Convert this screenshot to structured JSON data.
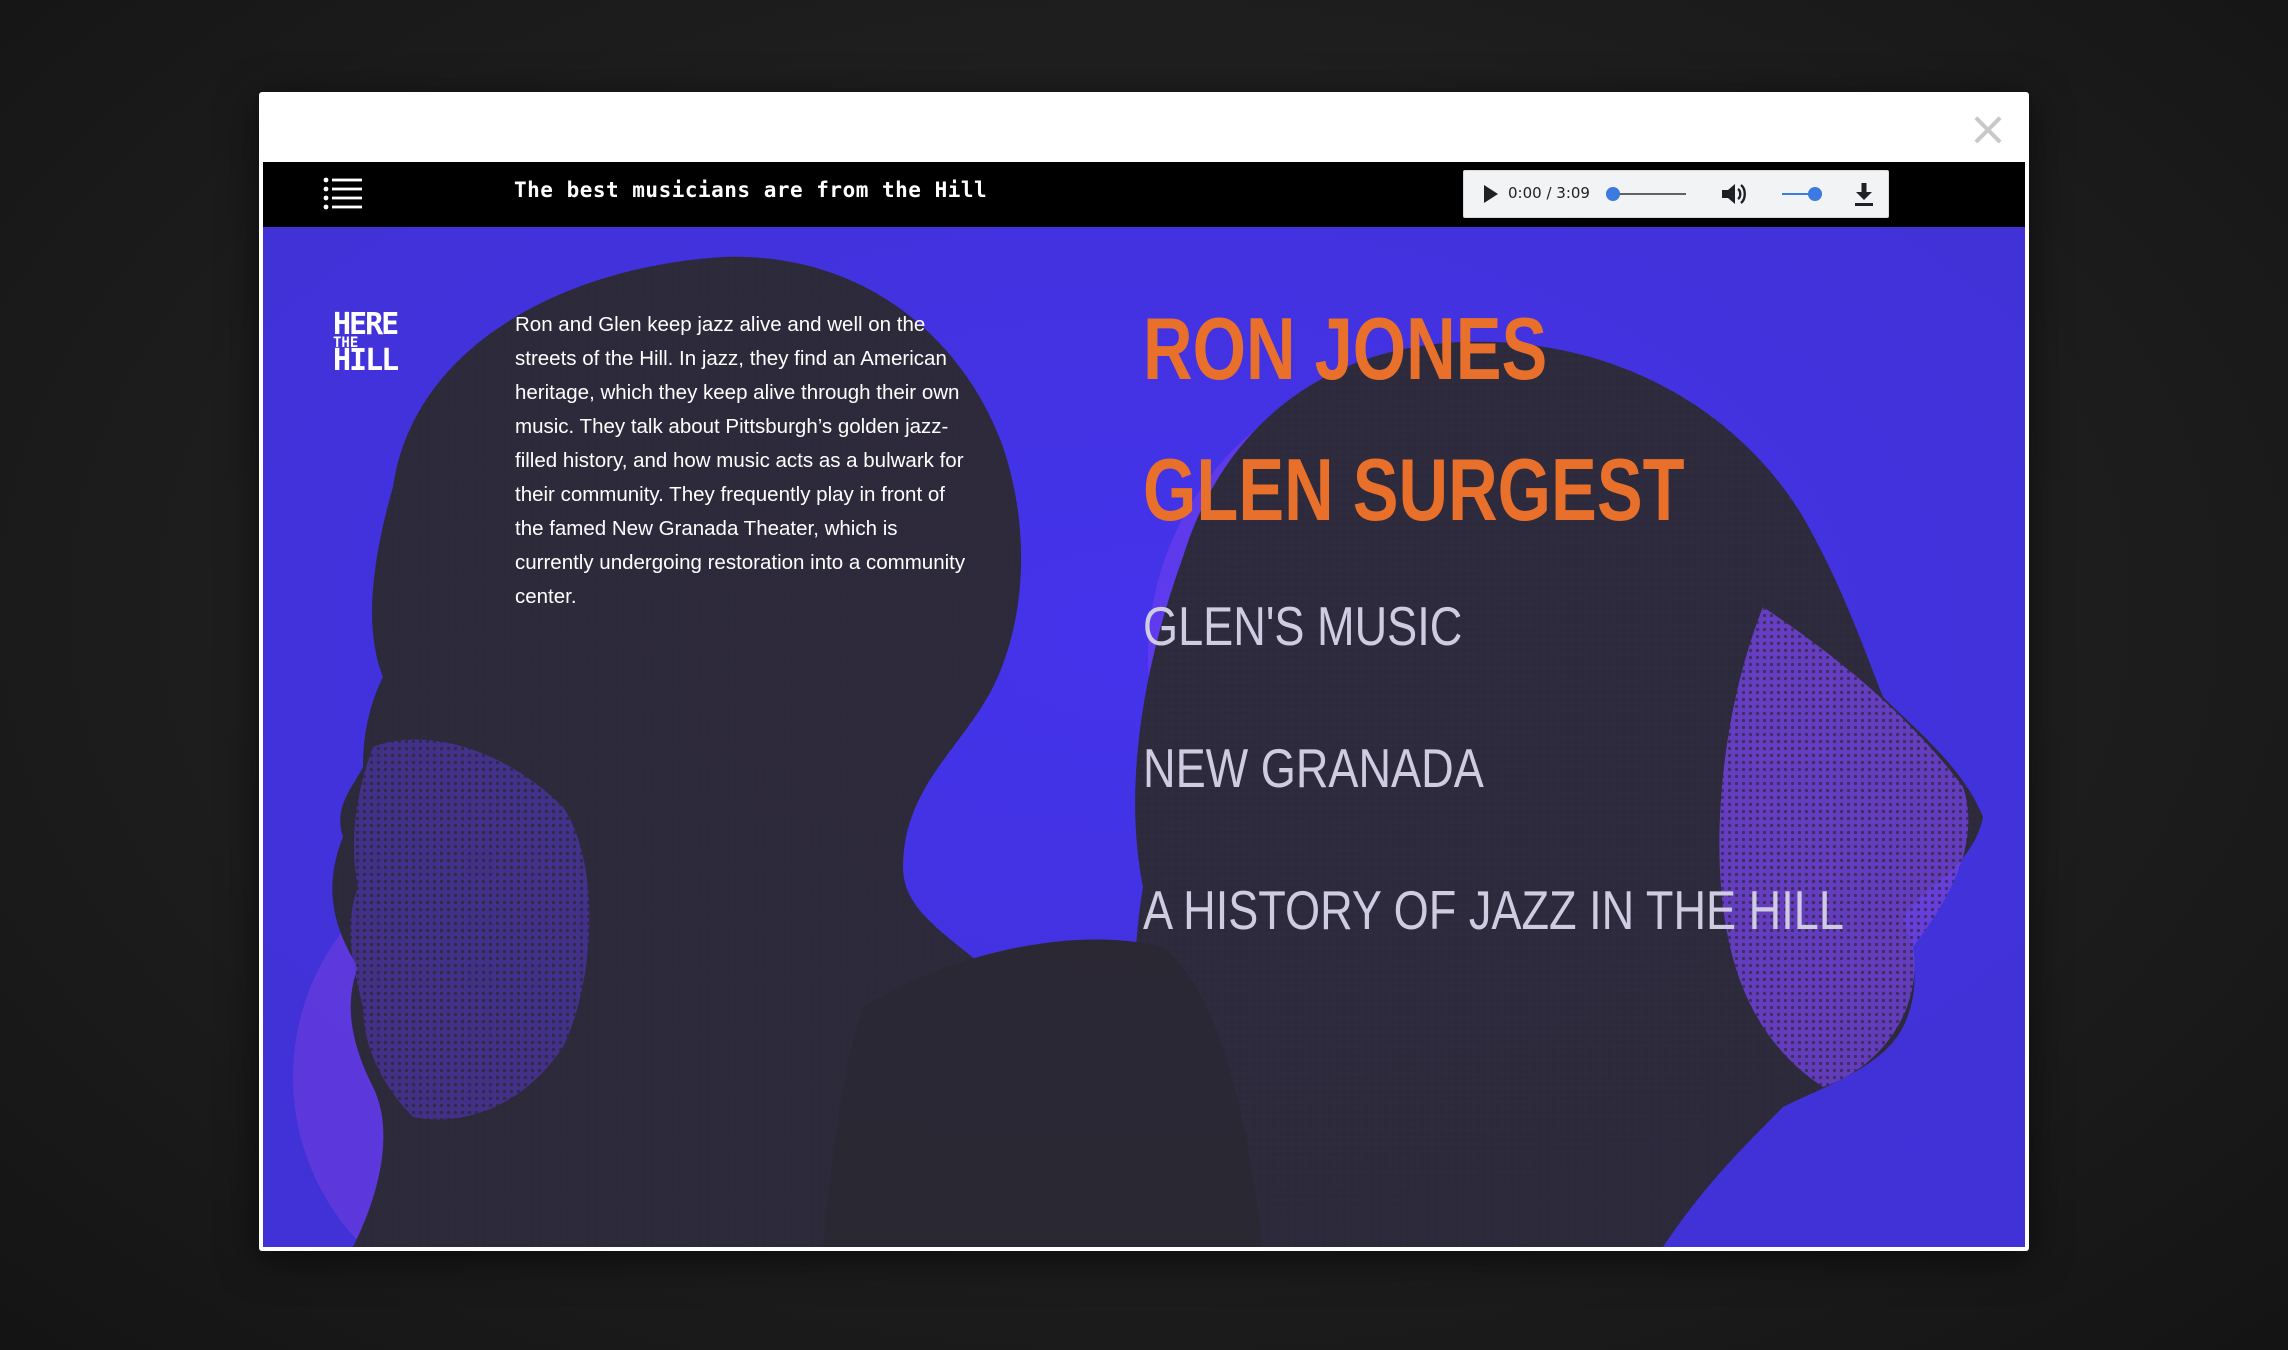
{
  "modal": {
    "close_label": "×"
  },
  "topbar": {
    "menu_icon": "menu-list-icon",
    "title": "The best musicians are from the Hill"
  },
  "audio": {
    "play_icon": "play-icon",
    "time": "0:00 / 3:09",
    "progress": 0.0,
    "volume_icon": "volume-icon",
    "volume": 0.8,
    "download_icon": "download-icon"
  },
  "logo": {
    "line1": "HERE",
    "line2": "THE",
    "line3": "HILL"
  },
  "intro": {
    "text": "Ron and Glen keep jazz alive and well on the streets of the Hill. In jazz, they find an American heritage, which they keep alive through their own music. They talk about Pittsburgh’s golden jazz-filled history, and how music acts as a bulwark for their community. They frequently play in front of the famed New Granada Theater, which is currently undergoing restoration into a community center."
  },
  "nav": {
    "items": [
      {
        "label": "RON JONES"
      },
      {
        "label": "GLEN SURGEST"
      },
      {
        "label": "GLEN'S MUSIC"
      },
      {
        "label": "NEW GRANADA"
      },
      {
        "label": "A HISTORY OF JAZZ IN THE HILL"
      }
    ]
  },
  "colors": {
    "background_blue": "#4433f0",
    "accent_orange": "#e8702a",
    "nav_secondary": "#cfcbe0",
    "overlay_purple": "#6a3df5",
    "halftone_dark": "#2e2c3a"
  }
}
